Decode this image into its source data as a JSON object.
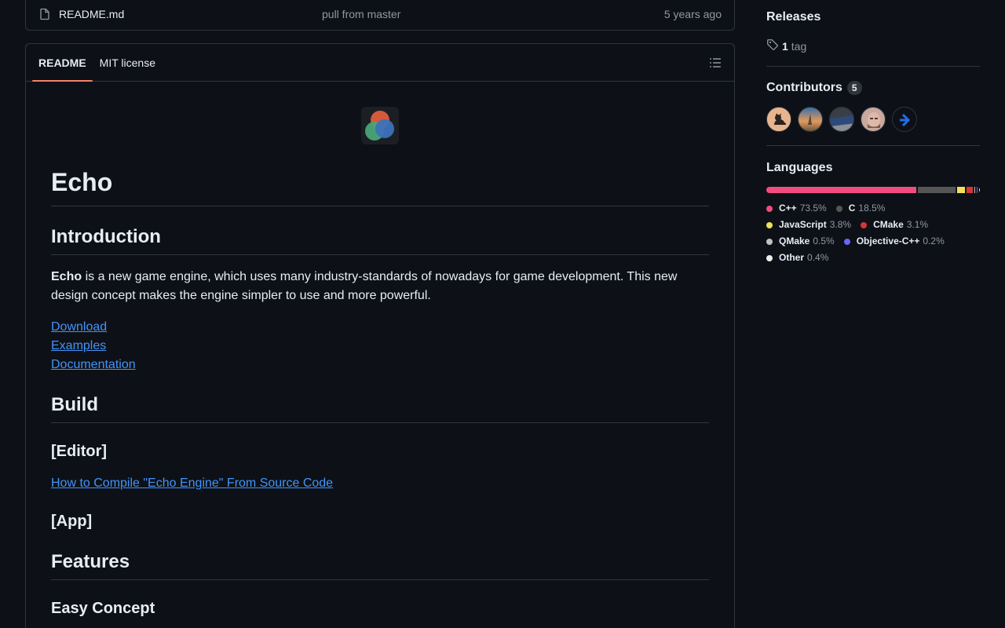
{
  "file_row": {
    "name": "README.md",
    "message": "pull from master",
    "date": "5 years ago"
  },
  "readme": {
    "tabs": [
      {
        "label": "README"
      },
      {
        "label": "MIT license"
      }
    ],
    "title": "Echo",
    "intro_heading": "Introduction",
    "intro_bold": "Echo",
    "intro_text": " is a new game engine, which uses many industry-standards of nowadays for game development. This new design concept makes the engine simpler to use and more powerful.",
    "links": [
      "Download",
      "Examples",
      "Documentation"
    ],
    "build_heading": "Build",
    "editor_heading": "[Editor]",
    "compile_link": "How to Compile \"Echo Engine\" From Source Code",
    "app_heading": "[App]",
    "features_heading": "Features",
    "easy_heading": "Easy Concept"
  },
  "sidebar": {
    "releases": {
      "title": "Releases",
      "tag_count": "1",
      "tag_label": "tag"
    },
    "contributors": {
      "title": "Contributors",
      "count": "5"
    },
    "languages": {
      "title": "Languages",
      "items": [
        {
          "name": "C++",
          "percent": "73.5%",
          "value": 73.5,
          "color": "#f34b7d"
        },
        {
          "name": "C",
          "percent": "18.5%",
          "value": 18.5,
          "color": "#555555"
        },
        {
          "name": "JavaScript",
          "percent": "3.8%",
          "value": 3.8,
          "color": "#f1e05a"
        },
        {
          "name": "CMake",
          "percent": "3.1%",
          "value": 3.1,
          "color": "#da3434"
        },
        {
          "name": "QMake",
          "percent": "0.5%",
          "value": 0.5,
          "color": "#c1c1c1"
        },
        {
          "name": "Objective-C++",
          "percent": "0.2%",
          "value": 0.2,
          "color": "#6866fb"
        },
        {
          "name": "Other",
          "percent": "0.4%",
          "value": 0.4,
          "color": "#ededed"
        }
      ]
    }
  },
  "icons": {
    "file": "file-icon",
    "toc": "list-unordered-icon",
    "tag": "tag-icon"
  }
}
